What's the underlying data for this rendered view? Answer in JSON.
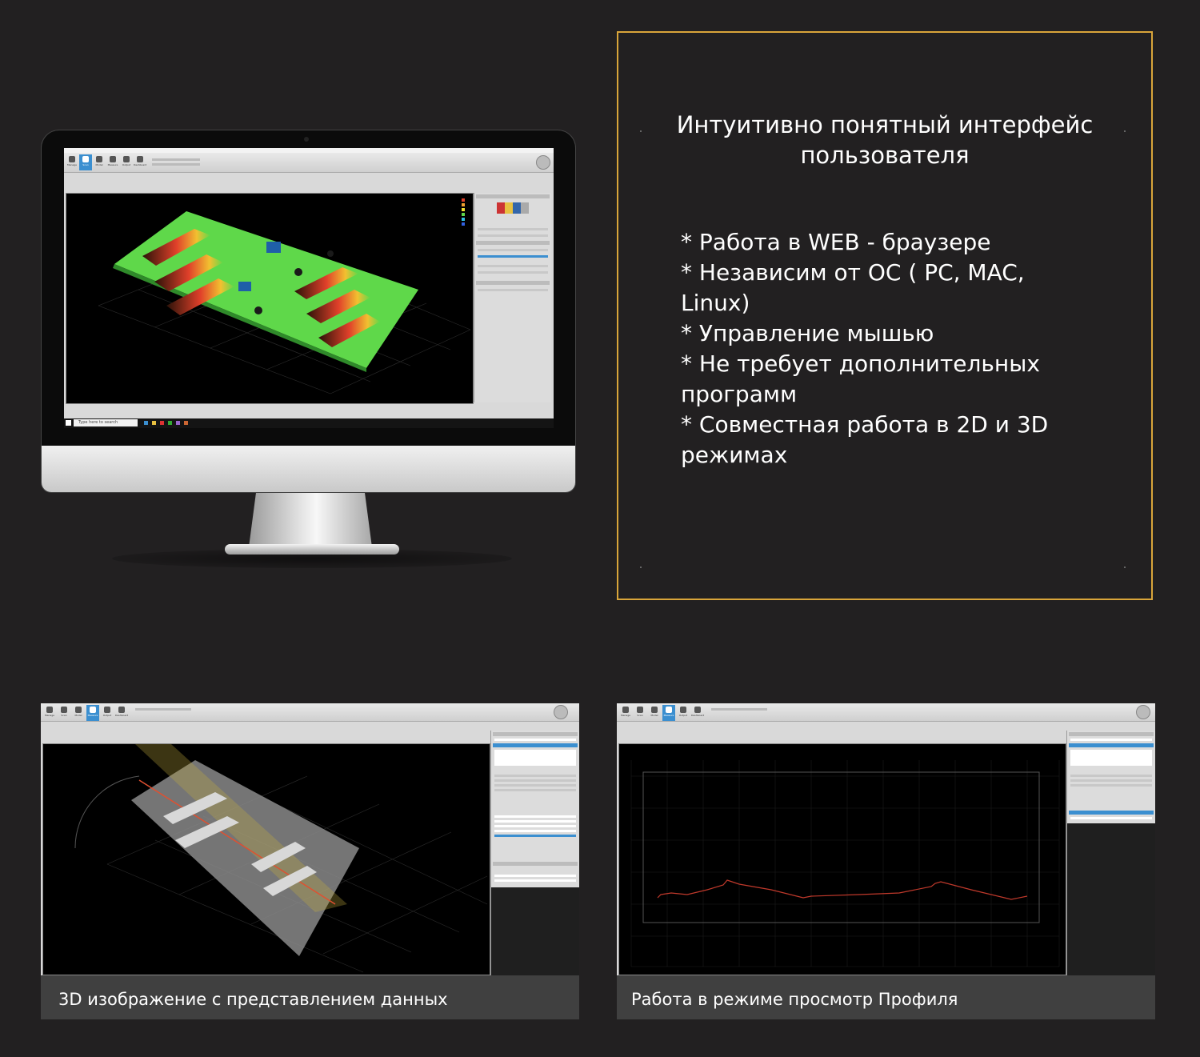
{
  "info_box": {
    "title_line1": "Интуитивно понятный интерфейс",
    "title_line2": "пользователя",
    "bullets": [
      "* Работа в WEB - браузере",
      "* Независим от ОС ( PC, MAC, Linux)",
      "* Управление мышью",
      "* Не требует дополнительных программ",
      "* Совместная работа в 2D и 3D режимах"
    ],
    "border_color": "#d9a53a"
  },
  "monitor": {
    "app_toolbar": [
      "Manage",
      "Scan",
      "Model",
      "Measure",
      "Output",
      "Dashboard"
    ],
    "active_tool": "Scan",
    "taskbar_search": "Type here to search",
    "scene": "3D surface height map (green-to-red)"
  },
  "shots": [
    {
      "caption": "3D изображение с представлением данных",
      "toolbar": [
        "Manage",
        "Scan",
        "Model",
        "Measure",
        "Output",
        "Dashboard"
      ],
      "active_tool": "Measure"
    },
    {
      "caption": "Работа в режиме просмотр Профиля",
      "toolbar": [
        "Manage",
        "Scan",
        "Model",
        "Measure",
        "Output",
        "Dashboard"
      ],
      "active_tool": "Measure"
    }
  ],
  "colors": {
    "background": "#222021",
    "accent_blue": "#3b8fd0",
    "profile_line": "#c0392b",
    "surface_green": "#5fd84a"
  }
}
